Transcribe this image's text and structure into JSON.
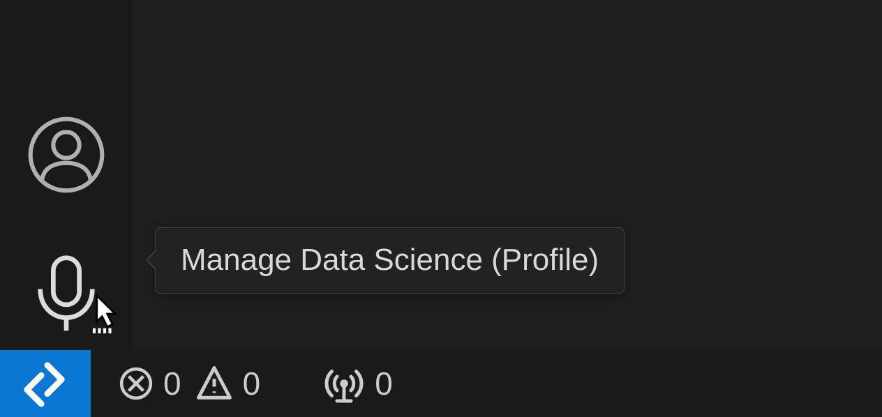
{
  "activityBar": {
    "accounts": "Accounts",
    "manage": "Manage"
  },
  "tooltip": {
    "text": "Manage Data Science (Profile)"
  },
  "statusBar": {
    "remoteLabel": "Remote",
    "errors": "0",
    "warnings": "0",
    "ports": "0"
  }
}
